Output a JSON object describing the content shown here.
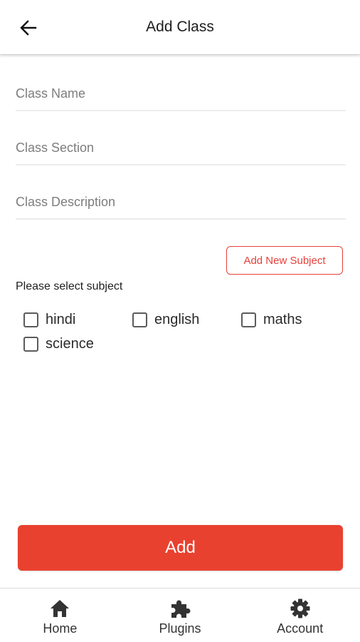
{
  "app_bar": {
    "title": "Add Class",
    "back_icon": "arrow-back-icon"
  },
  "form": {
    "class_name": {
      "placeholder": "Class Name",
      "value": ""
    },
    "class_section": {
      "placeholder": "Class Section",
      "value": ""
    },
    "class_description": {
      "placeholder": "Class Description",
      "value": ""
    }
  },
  "add_subject_label": "Add New Subject",
  "select_subject_label": "Please select subject",
  "subjects": [
    {
      "label": "hindi",
      "checked": false
    },
    {
      "label": "english",
      "checked": false
    },
    {
      "label": "maths",
      "checked": false
    },
    {
      "label": "science",
      "checked": false
    }
  ],
  "add_button_label": "Add",
  "bottom_nav": [
    {
      "label": "Home",
      "icon": "home-icon"
    },
    {
      "label": "Plugins",
      "icon": "puzzle-icon"
    },
    {
      "label": "Account",
      "icon": "gear-icon"
    }
  ],
  "colors": {
    "accent": "#e9412f",
    "outline_accent": "#e6403a"
  }
}
